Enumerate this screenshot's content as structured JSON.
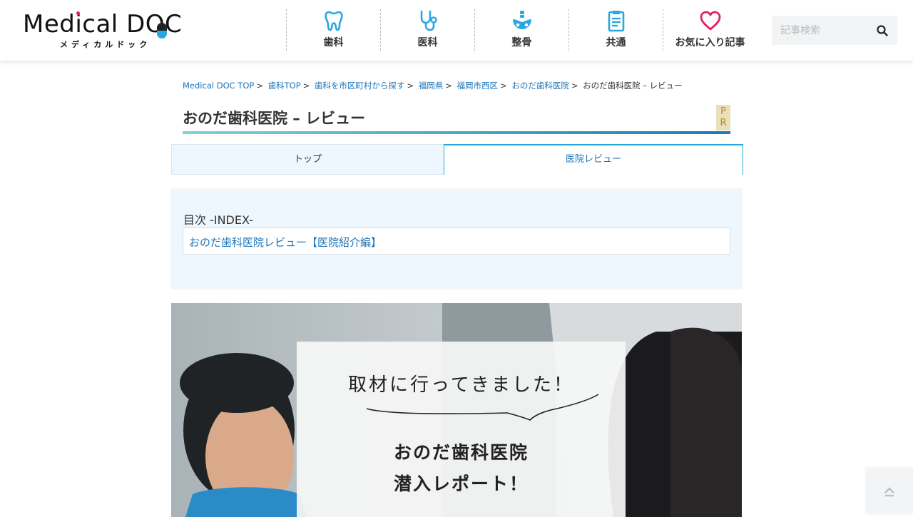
{
  "header": {
    "logo_text": "Medical DOC",
    "logo_sub": "メディカルドック",
    "nav": [
      {
        "label": "歯科",
        "icon": "tooth-icon"
      },
      {
        "label": "医科",
        "icon": "stethoscope-icon"
      },
      {
        "label": "整骨",
        "icon": "pelvis-bone-icon"
      },
      {
        "label": "共通",
        "icon": "clipboard-icon"
      },
      {
        "label": "お気に入り記事",
        "icon": "heart-icon"
      }
    ],
    "search_placeholder": "記事検索",
    "accent_color": "#2aa7e0",
    "brand_pink": "#e0245e"
  },
  "breadcrumb": {
    "items": [
      "Medical DOC TOP",
      "歯科TOP",
      "歯科を市区町村から探す",
      "福岡県",
      "福岡市西区",
      "おのだ歯科医院"
    ],
    "current": "おのだ歯科医院 – レビュー"
  },
  "page": {
    "title": "おのだ歯科医院 – レビュー",
    "pr_label_1": "P",
    "pr_label_2": "R"
  },
  "tabs": {
    "top_label": "トップ",
    "review_label": "医院レビュー"
  },
  "toc": {
    "heading": "目次 -INDEX-",
    "link": "おのだ歯科医院レビュー【医院紹介編】"
  },
  "hero": {
    "line1": "取材に行ってきました！",
    "line2": "おのだ歯科医院",
    "line3": "潜入レポート！"
  }
}
